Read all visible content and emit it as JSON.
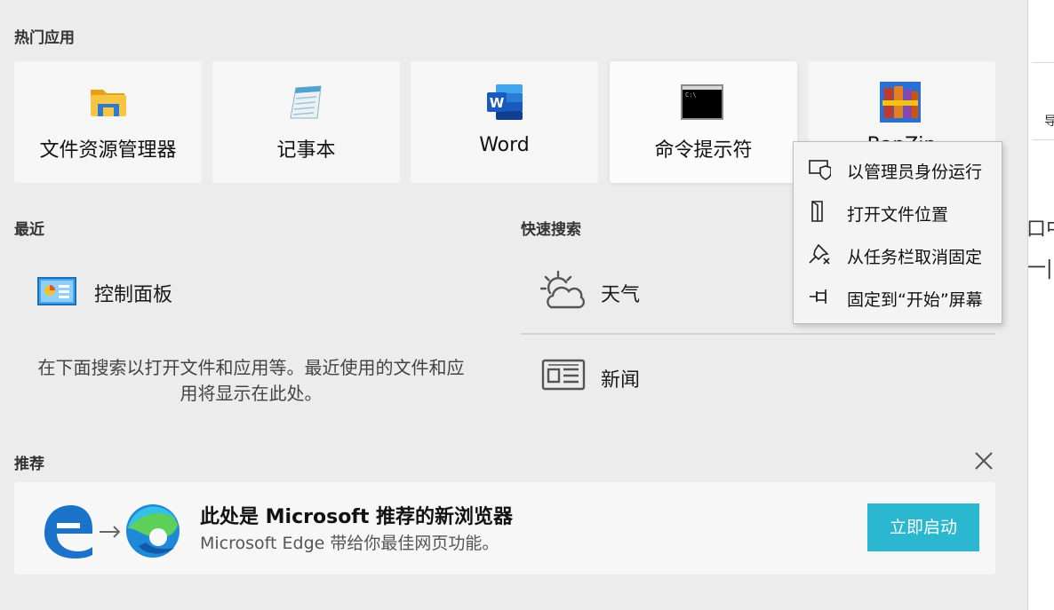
{
  "colors": {
    "panel_bg": "#ececec",
    "tile_bg": "#f6f6f6",
    "accent_button": "#2bb7cf",
    "menu_bg": "#f4f4f4"
  },
  "top_apps": {
    "title": "热门应用",
    "items": [
      {
        "label": "文件资源管理器",
        "icon": "folder-icon"
      },
      {
        "label": "记事本",
        "icon": "notepad-icon"
      },
      {
        "label": "Word",
        "icon": "word-icon"
      },
      {
        "label": "命令提示符",
        "icon": "cmd-icon"
      },
      {
        "label": "BanZip",
        "icon": "bandizip-icon"
      }
    ]
  },
  "recent": {
    "title": "最近",
    "items": [
      {
        "label": "控制面板",
        "icon": "control-panel-icon"
      }
    ],
    "empty_hint": "在下面搜索以打开文件和应用等。最近使用的文件和应用将显示在此处。"
  },
  "quick_search": {
    "title": "快速搜索",
    "items": [
      {
        "label": "天气",
        "icon": "weather-icon"
      },
      {
        "label": "新闻",
        "icon": "news-icon"
      }
    ]
  },
  "recommended": {
    "title": "推荐",
    "card_title": "此处是 Microsoft 推荐的新浏览器",
    "card_subtitle": "Microsoft Edge 带给你最佳网页功能。",
    "button_label": "立即启动"
  },
  "context_menu": {
    "items": [
      {
        "label": "以管理员身份运行",
        "icon": "admin-shield-icon"
      },
      {
        "label": "打开文件位置",
        "icon": "file-location-icon"
      },
      {
        "label": "从任务栏取消固定",
        "icon": "unpin-icon"
      },
      {
        "label": "固定到“开始”屏幕",
        "icon": "pin-icon"
      }
    ]
  },
  "right_strip": {
    "text1": "口中",
    "text2": "一|",
    "text3": "导"
  }
}
